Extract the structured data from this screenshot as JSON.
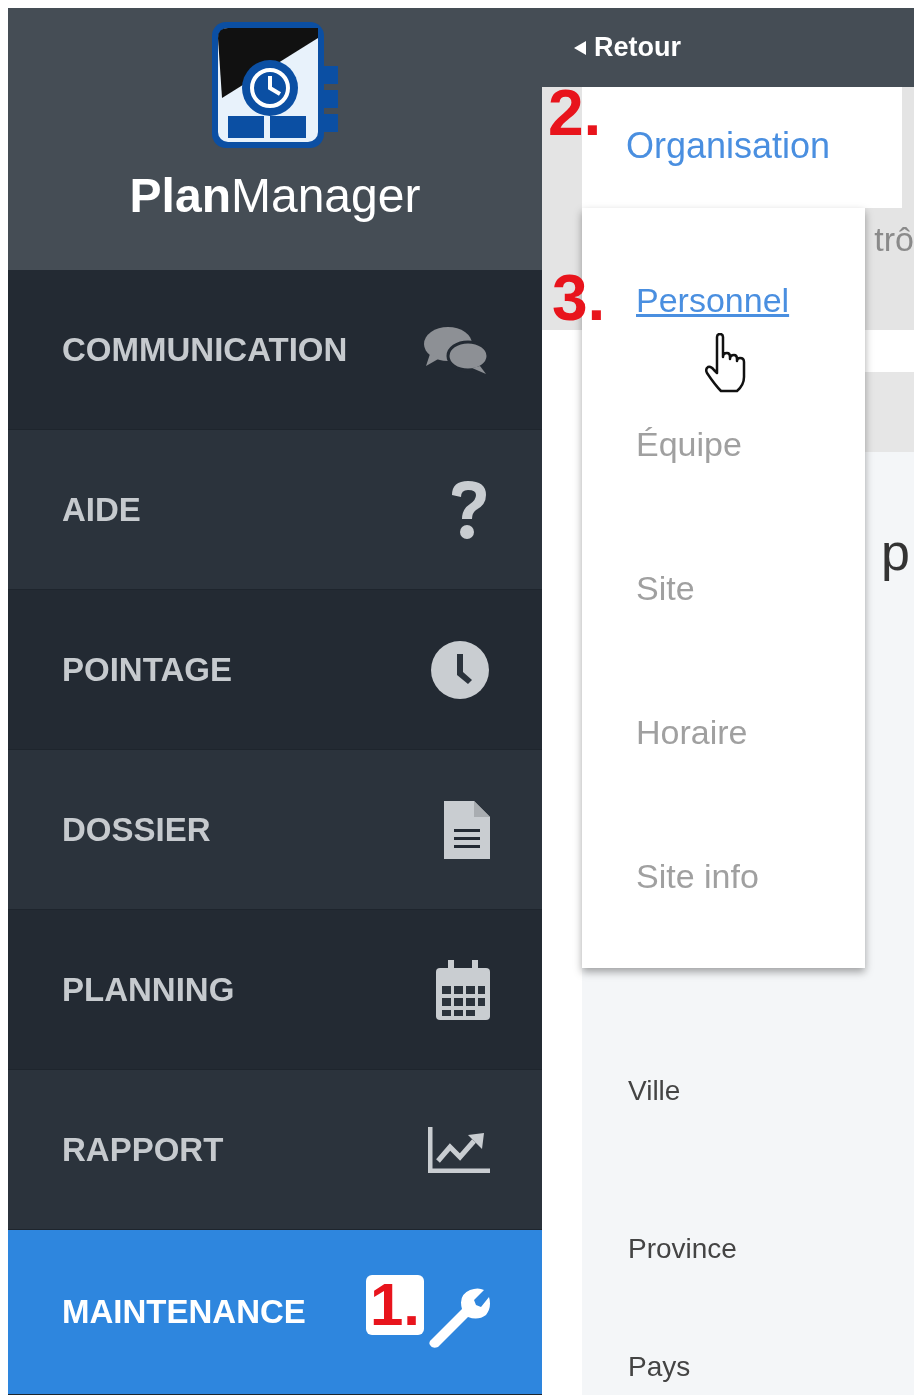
{
  "logo": {
    "name": "**Plan**Manager"
  },
  "sidebar": {
    "items": [
      {
        "label": "COMMUNICATION",
        "kind": "chat",
        "selected": false
      },
      {
        "label": "AIDE",
        "kind": "question",
        "selected": false
      },
      {
        "label": "POINTAGE",
        "kind": "clock",
        "selected": false
      },
      {
        "label": "DOSSIER",
        "kind": "file",
        "selected": false
      },
      {
        "label": "PLANNING",
        "kind": "calendar",
        "selected": false
      },
      {
        "label": "RAPPORT",
        "kind": "chart",
        "selected": false
      },
      {
        "label": "MAINTENANCE",
        "kind": "wrench",
        "selected": true,
        "step": "1."
      }
    ]
  },
  "top_bar": {
    "back": "Retour"
  },
  "tabs": [
    {
      "label": "Organisation",
      "selected": true,
      "step": "2."
    }
  ],
  "dropdown": {
    "items": [
      {
        "label": "Personnel",
        "selected": true,
        "step": "3."
      },
      {
        "label": "Équipe",
        "selected": false
      },
      {
        "label": "Site",
        "selected": false
      },
      {
        "label": "Horaire",
        "selected": false
      },
      {
        "label": "Site info",
        "selected": false
      }
    ]
  },
  "background": {
    "tab_partial": "trô",
    "heading_partial": "p"
  },
  "form": {
    "labels": [
      "Ville",
      "Province",
      "Pays"
    ]
  }
}
